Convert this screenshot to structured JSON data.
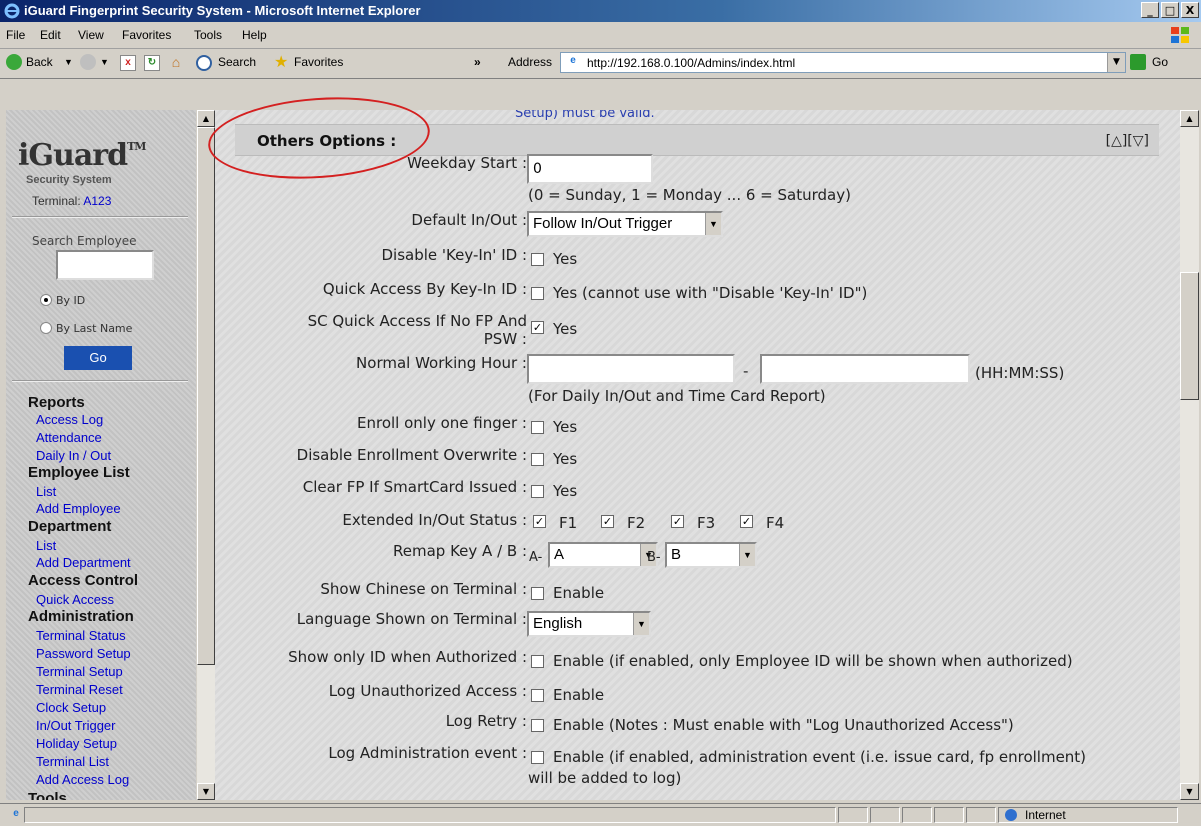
{
  "window": {
    "title": "iGuard Fingerprint Security System - Microsoft Internet Explorer",
    "buttons": [
      "_",
      "□",
      "X"
    ]
  },
  "menubar": {
    "items": [
      "File",
      "Edit",
      "View",
      "Favorites",
      "Tools",
      "Help"
    ]
  },
  "toolbar": {
    "back": "Back",
    "search": "Search",
    "favorites": "Favorites",
    "chevron": "»",
    "address_label": "Address",
    "url": "http://192.168.0.100/Admins/index.html",
    "go": "Go"
  },
  "sidebar": {
    "logo": "iGuard",
    "logo_tm": "TM",
    "logo_sub": "Security System",
    "terminal_label": "Terminal:",
    "terminal_id": "A123",
    "search_label": "Search Employee",
    "radio_by_id": "By ID",
    "radio_by_last_name": "By Last Name",
    "go": "Go",
    "sections": [
      {
        "heading": "Reports",
        "links": [
          "Access Log",
          "Attendance",
          "Daily In / Out"
        ]
      },
      {
        "heading": "Employee List",
        "links": [
          "List",
          "Add Employee"
        ]
      },
      {
        "heading": "Department",
        "links": [
          "List",
          "Add Department"
        ]
      },
      {
        "heading": "Access Control",
        "links": [
          "Quick Access"
        ]
      },
      {
        "heading": "Administration",
        "links": [
          "Terminal Status",
          "Password Setup",
          "Terminal Setup",
          "Terminal Reset",
          "Clock Setup",
          "In/Out Trigger",
          "Holiday Setup",
          "Terminal List",
          "Add Access Log"
        ]
      },
      {
        "heading": "Tools",
        "links": []
      }
    ]
  },
  "main": {
    "top_fragment": "Setup) must be valid.",
    "section_title": "Others Options :",
    "section_arrows": "[△][▽]",
    "weekday_start": {
      "label": "Weekday Start :",
      "value": "0",
      "hint": "(0 = Sunday, 1 = Monday ... 6 = Saturday)"
    },
    "default_inout": {
      "label": "Default In/Out :",
      "value": "Follow In/Out Trigger"
    },
    "disable_keyin": {
      "label": "Disable 'Key-In' ID :",
      "option": "Yes",
      "checked": false
    },
    "quick_access_keyin": {
      "label": "Quick Access By Key-In ID :",
      "option": "Yes (cannot use with \"Disable 'Key-In' ID\")",
      "checked": false
    },
    "sc_quick_access": {
      "label_line1": "SC Quick Access If No FP And",
      "label_line2": "PSW :",
      "option": "Yes",
      "checked": true
    },
    "normal_working_hour": {
      "label": "Normal Working Hour :",
      "separator": "-",
      "format": "(HH:MM:SS)",
      "hint": "(For Daily In/Out and Time Card Report)"
    },
    "enroll_one_finger": {
      "label": "Enroll only one finger :",
      "option": "Yes",
      "checked": false
    },
    "disable_enroll_overwrite": {
      "label": "Disable Enrollment Overwrite :",
      "option": "Yes",
      "checked": false
    },
    "clear_fp": {
      "label": "Clear FP If SmartCard Issued :",
      "option": "Yes",
      "checked": false
    },
    "extended_status": {
      "label": "Extended In/Out Status :",
      "options": [
        "F1",
        "F2",
        "F3",
        "F4"
      ],
      "checked": [
        true,
        true,
        true,
        true
      ]
    },
    "remap_key": {
      "label": "Remap Key A / B :",
      "a_prefix": "A-",
      "a_value": "A",
      "b_prefix": "B-",
      "b_value": "B"
    },
    "show_chinese": {
      "label": "Show Chinese on Terminal :",
      "option": "Enable",
      "checked": false
    },
    "language": {
      "label": "Language Shown on Terminal :",
      "value": "English"
    },
    "show_only_id": {
      "label": "Show only ID when Authorized :",
      "option": "Enable (if enabled, only Employee ID will be shown when authorized)",
      "checked": false
    },
    "log_unauth": {
      "label": "Log Unauthorized Access :",
      "option": "Enable",
      "checked": false
    },
    "log_retry": {
      "label": "Log Retry :",
      "option": "Enable (Notes : Must enable with \"Log Unauthorized Access\")",
      "checked": false
    },
    "log_admin": {
      "label": "Log Administration event :",
      "option": "Enable (if enabled, administration event (i.e. issue card, fp enrollment)",
      "option_line2": "will be added to log)",
      "checked": false
    }
  },
  "statusbar": {
    "zone": "Internet"
  }
}
